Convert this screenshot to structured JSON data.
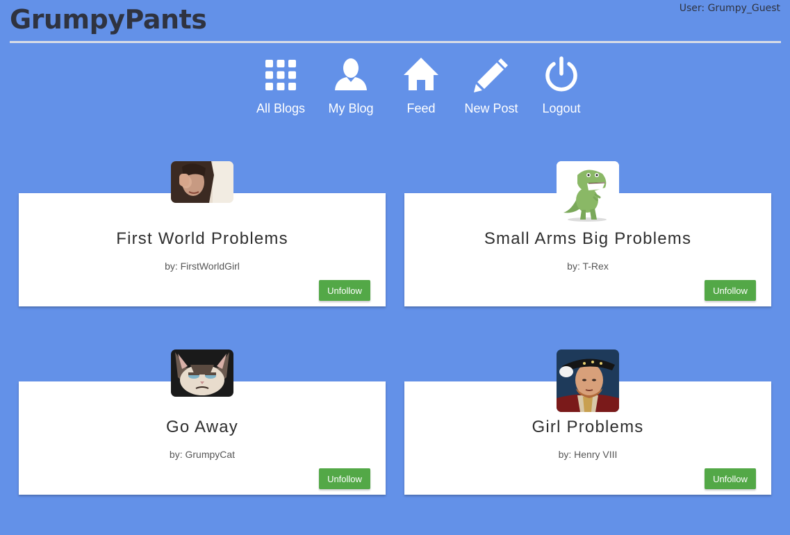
{
  "app": {
    "title": "GrumpyPants",
    "user_label": "User: Grumpy_Guest"
  },
  "nav": [
    {
      "label": "All Blogs",
      "icon": "grid-icon"
    },
    {
      "label": "My Blog",
      "icon": "user-icon"
    },
    {
      "label": "Feed",
      "icon": "home-icon"
    },
    {
      "label": "New Post",
      "icon": "pencil-icon"
    },
    {
      "label": "Logout",
      "icon": "power-icon"
    }
  ],
  "blogs": [
    {
      "title": "First World Problems",
      "author": "by: FirstWorldGirl",
      "button": "Unfollow",
      "avatar": "crying-woman"
    },
    {
      "title": "Small Arms Big Problems",
      "author": "by: T-Rex",
      "button": "Unfollow",
      "avatar": "t-rex"
    },
    {
      "title": "Go Away",
      "author": "by: GrumpyCat",
      "button": "Unfollow",
      "avatar": "grumpy-cat"
    },
    {
      "title": "Girl Problems",
      "author": "by: Henry VIII",
      "button": "Unfollow",
      "avatar": "henry-viii"
    }
  ],
  "colors": {
    "background": "#6391e8",
    "button": "#53a847",
    "logo": "#2f3340"
  }
}
